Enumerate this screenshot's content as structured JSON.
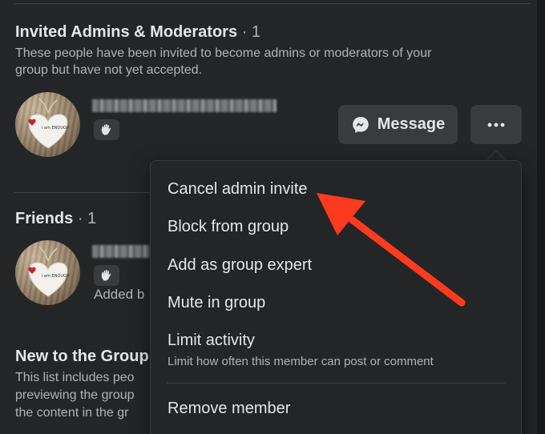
{
  "invited": {
    "title": "Invited Admins & Moderators",
    "count": "· 1",
    "description_line1": "These people have been invited to become admins or moderators of your",
    "description_line2": "group but have not yet accepted.",
    "message_label": "Message",
    "more_icon": "ellipsis-icon",
    "badge_icon": "wave-hand-icon"
  },
  "friends": {
    "title": "Friends",
    "count": "· 1",
    "added_by": "Added b",
    "badge_icon": "wave-hand-icon"
  },
  "new_to_group": {
    "title": "New to the Group",
    "description_line1": "This list includes peo",
    "description_line2": "previewing the group",
    "description_line3": "the content in the gr"
  },
  "avatar_text": "i am ENOUGH",
  "menu": {
    "items": [
      {
        "label": "Cancel admin invite"
      },
      {
        "label": "Block from group"
      },
      {
        "label": "Add as group expert"
      },
      {
        "label": "Mute in group"
      },
      {
        "label": "Limit activity",
        "sublabel": "Limit how often this member can post or comment"
      },
      {
        "label": "Remove member"
      }
    ]
  },
  "colors": {
    "background": "#242526",
    "button": "#3a3b3c",
    "text_primary": "#e4e6eb",
    "text_secondary": "#b0b3b8",
    "annotation_arrow": "#ff3b1f"
  }
}
